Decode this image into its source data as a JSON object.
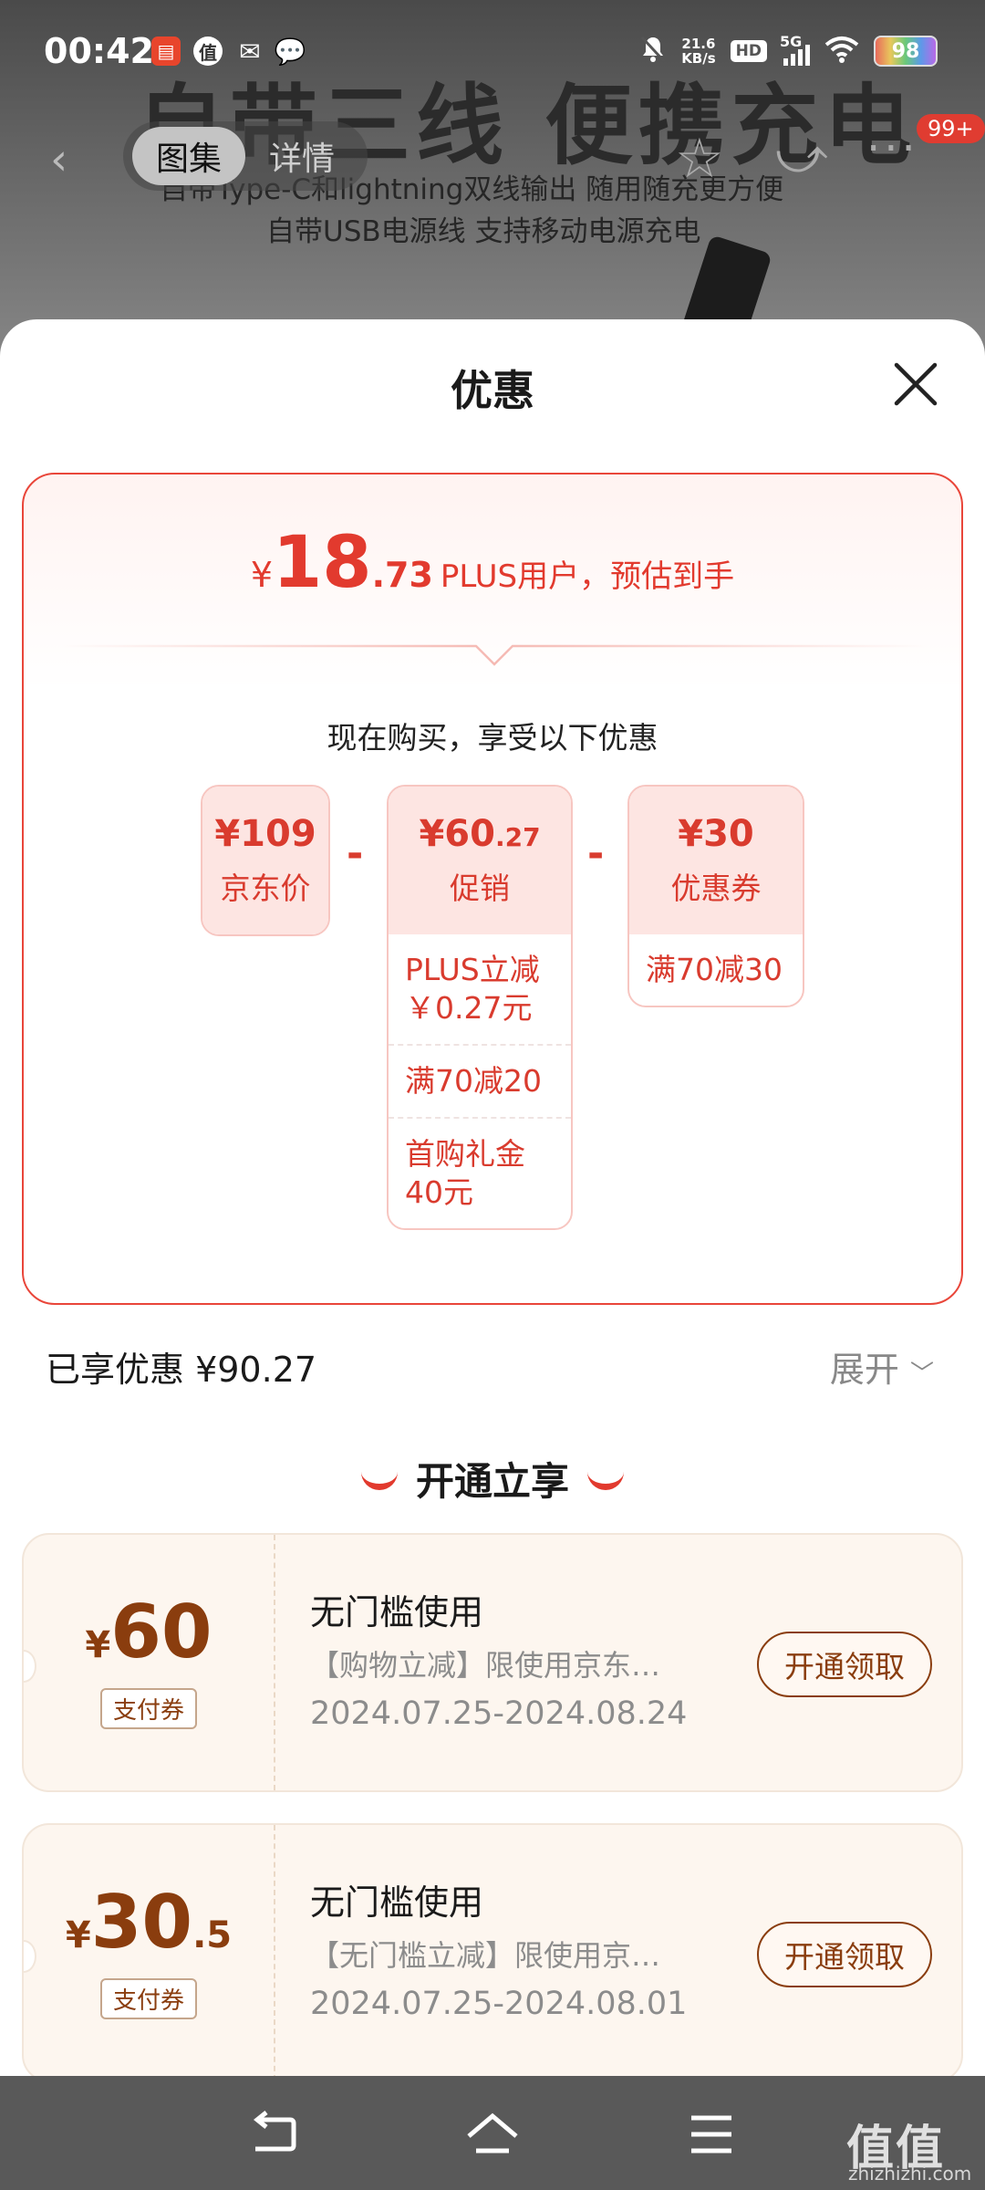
{
  "status_bar": {
    "time": "00:42",
    "net_speed_value": "21.6",
    "net_speed_unit": "KB/s",
    "hd_label": "HD",
    "network": "5G",
    "battery": "98"
  },
  "background_page": {
    "ad_headline": "自带三线 便携充电",
    "ad_line1": "自带Type-C和lightning双线输出 随用随充更方便",
    "ad_line2": "自带USB电源线 支持移动电源充电",
    "tabs": [
      {
        "label": "图集",
        "active": true
      },
      {
        "label": "详情",
        "active": false
      }
    ],
    "cart_badge": "99+"
  },
  "sheet": {
    "title": "优惠",
    "price_summary": {
      "currency": "¥",
      "integer": "18",
      "decimal": ".73",
      "text": "PLUS用户，预估到手"
    },
    "subtitle": "现在购买，享受以下优惠",
    "boxes": [
      {
        "currency": "¥",
        "amount": "109",
        "decimal": "",
        "label": "京东价",
        "rows": []
      },
      {
        "currency": "¥",
        "amount": "60",
        "decimal": ".27",
        "label": "促销",
        "rows": [
          "PLUS立减￥0.27元",
          "满70减20",
          "首购礼金40元"
        ]
      },
      {
        "currency": "¥",
        "amount": "30",
        "decimal": "",
        "label": "优惠券",
        "rows": [
          "满70减30"
        ]
      }
    ],
    "minus_sign": "-",
    "enjoyed_label": "已享优惠 ¥90.27",
    "expand_label": "展开",
    "section_title": "开通立享",
    "coupons": [
      {
        "currency": "¥",
        "amount": "60",
        "decimal": "",
        "tag": "支付券",
        "title": "无门槛使用",
        "desc": "【购物立减】限使用京东…",
        "date": "2024.07.25-2024.08.24",
        "button": "开通领取"
      },
      {
        "currency": "¥",
        "amount": "30",
        "decimal": ".5",
        "tag": "支付券",
        "title": "无门槛使用",
        "desc": "【无门槛立减】限使用京…",
        "date": "2024.07.25-2024.08.01",
        "button": "开通领取"
      }
    ]
  },
  "watermark": {
    "main": "值值值",
    "sub": "zhizhizhi.com"
  },
  "colors": {
    "accent_red": "#e23a2e",
    "coupon_brown": "#8a3d0e",
    "card_pink": "#fde5e2"
  }
}
